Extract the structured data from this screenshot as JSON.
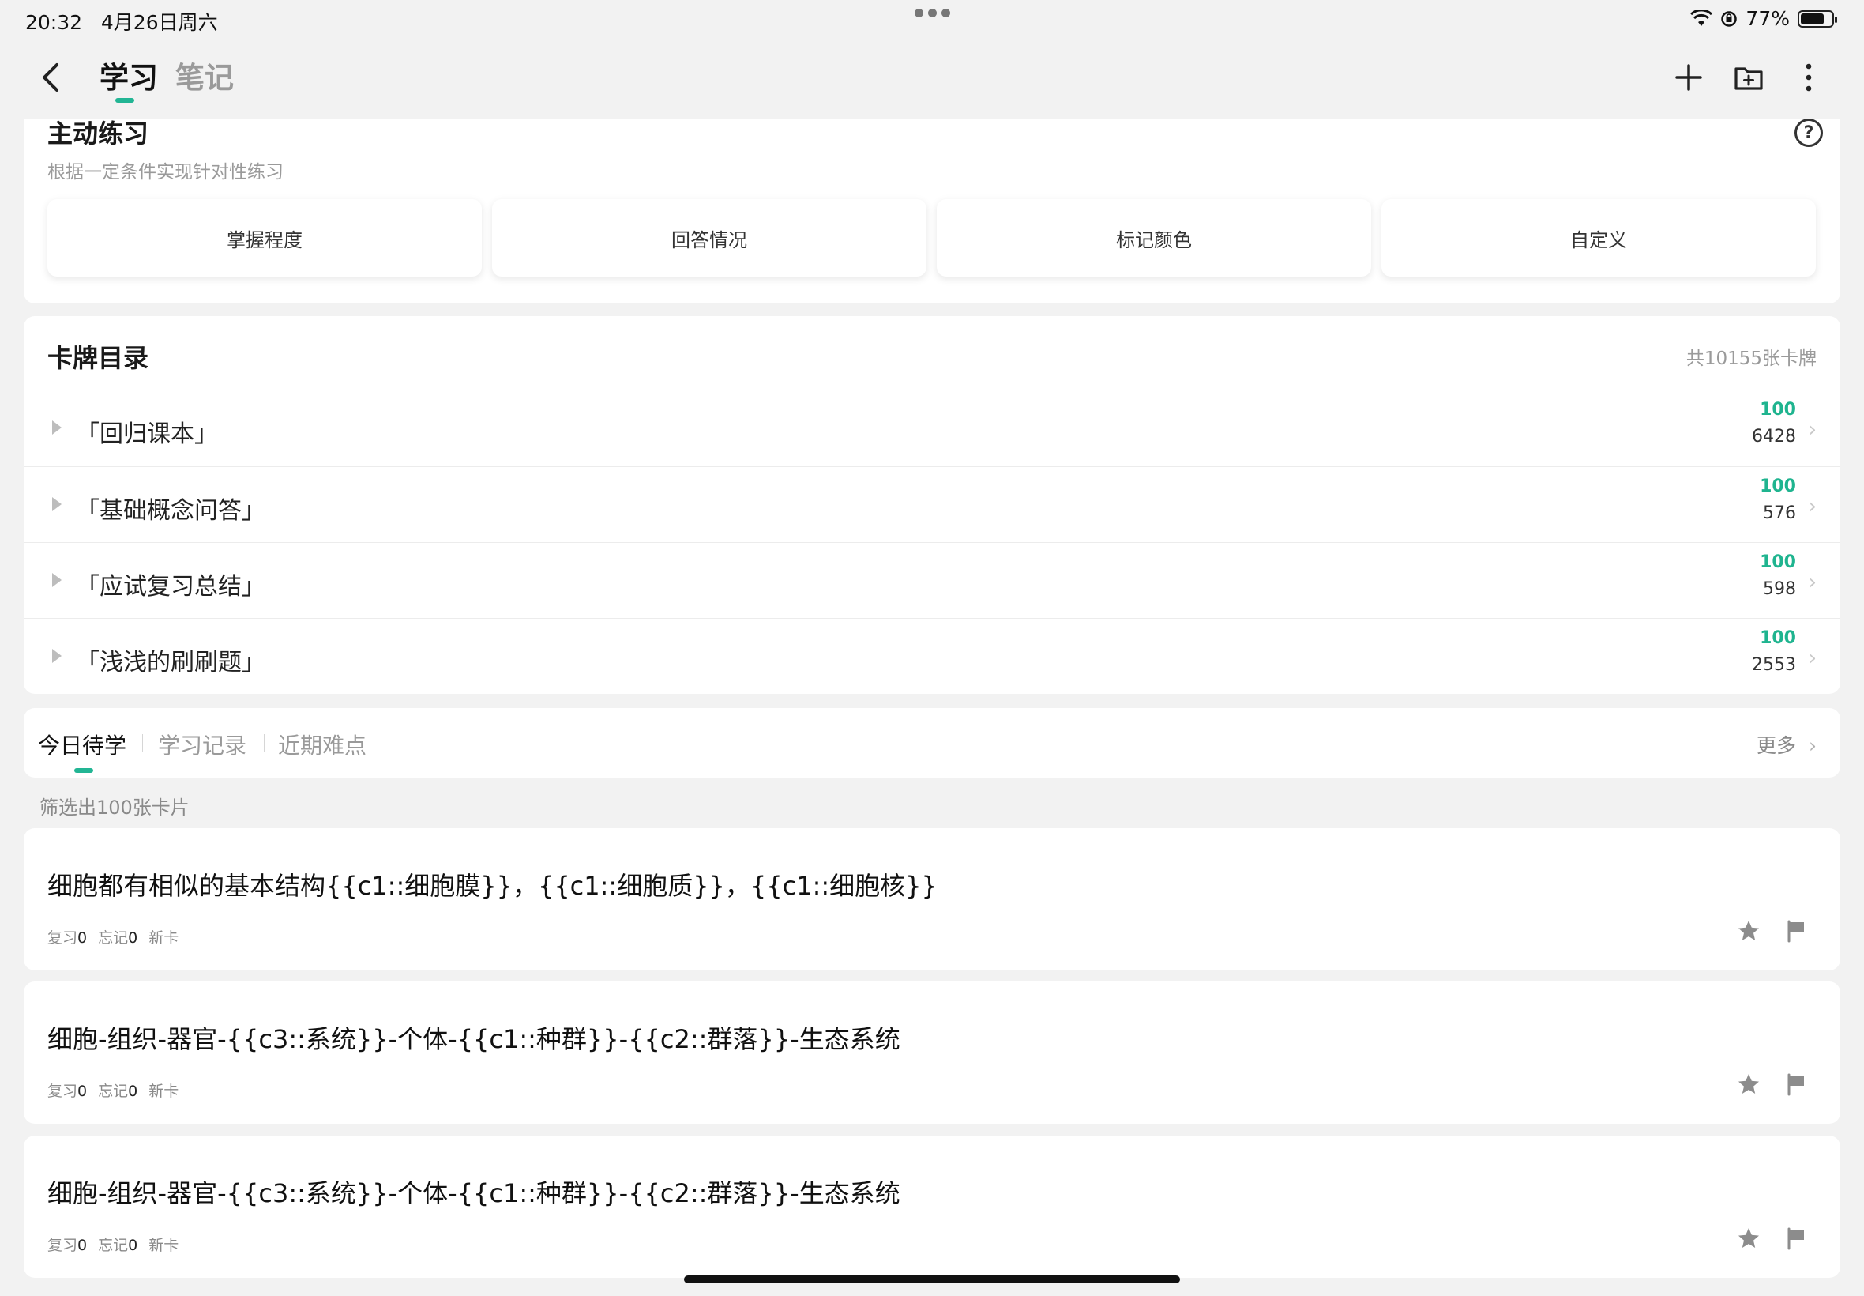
{
  "status_bar": {
    "time": "20:32",
    "date": "4月26日周六",
    "battery": "77%",
    "battery_level": 0.77
  },
  "nav": {
    "tabs": [
      {
        "label": "学习",
        "active": true
      },
      {
        "label": "笔记",
        "active": false
      }
    ],
    "icons": [
      "back-icon",
      "add-icon",
      "new-folder-icon",
      "more-vertical-icon"
    ]
  },
  "practice": {
    "title": "主动练习",
    "subtitle": "根据一定条件实现针对性练习",
    "help": "?",
    "modes": [
      "掌握程度",
      "回答情况",
      "标记颜色",
      "自定义"
    ]
  },
  "catalog": {
    "title": "卡牌目录",
    "total": "共10155张卡牌",
    "decks": [
      {
        "name": "「回归课本」",
        "due": "100",
        "count": "6428"
      },
      {
        "name": "「基础概念问答」",
        "due": "100",
        "count": "576"
      },
      {
        "name": "「应试复习总结」",
        "due": "100",
        "count": "598"
      },
      {
        "name": "「浅浅的刷刷题」",
        "due": "100",
        "count": "2553"
      }
    ]
  },
  "study_tabs": {
    "tabs": [
      "今日待学",
      "学习记录",
      "近期难点"
    ],
    "active": 0,
    "more": "更多"
  },
  "filter_text": "筛选出100张卡片",
  "cards": [
    {
      "question": "细胞都有相似的基本结构{{c1::细胞膜}}，{{c1::细胞质}}，{{c1::细胞核}}",
      "review_label": "复习",
      "review": "0",
      "forget_label": "忘记",
      "forget": "0",
      "state": "新卡"
    },
    {
      "question": "细胞-组织-器官-{{c3::系统}}-个体-{{c1::种群}}-{{c2::群落}}-生态系统",
      "review_label": "复习",
      "review": "0",
      "forget_label": "忘记",
      "forget": "0",
      "state": "新卡"
    },
    {
      "question": "细胞-组织-器官-{{c3::系统}}-个体-{{c1::种群}}-{{c2::群落}}-生态系统",
      "review_label": "复习",
      "review": "0",
      "forget_label": "忘记",
      "forget": "0",
      "state": "新卡"
    }
  ],
  "colors": {
    "accent": "#22b594",
    "due_count": "#1fb48f",
    "background": "#f2f2f2"
  }
}
